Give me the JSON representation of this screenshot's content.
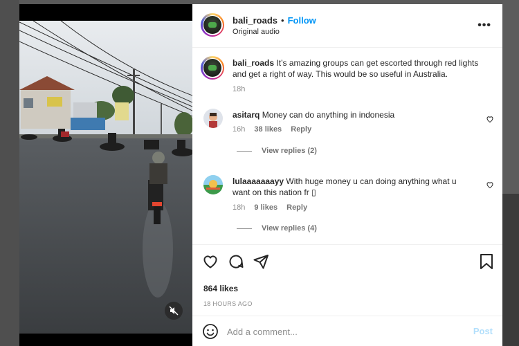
{
  "post": {
    "username": "bali_roads",
    "separator": "•",
    "follow_label": "Follow",
    "audio": "Original audio",
    "more_glyph": "•••"
  },
  "caption": {
    "username": "bali_roads",
    "text": "It’s amazing groups can get escorted through red lights and get a right of way. This would be so useful in Australia.",
    "time": "18h"
  },
  "comments": [
    {
      "username": "asitarq",
      "text": "Money can do anything in indonesia",
      "time": "16h",
      "likes": "38 likes",
      "reply_label": "Reply",
      "view_replies": "View replies (2)"
    },
    {
      "username": "lulaaaaaaayy",
      "text": "With huge money u can doing anything what u want on this nation fr ▯",
      "time": "18h",
      "likes": "9 likes",
      "reply_label": "Reply",
      "view_replies": "View replies (4)"
    }
  ],
  "engagement": {
    "likes": "864 likes",
    "posted": "18 HOURS AGO"
  },
  "comment_box": {
    "placeholder": "Add a comment...",
    "post_label": "Post"
  },
  "icons": {
    "like": "heart-icon",
    "comment": "comment-bubble-icon",
    "share": "paper-plane-icon",
    "save": "bookmark-icon",
    "emoji": "smiley-icon",
    "mute": "speaker-muted-icon",
    "more": "more-options-icon"
  },
  "colors": {
    "accent": "#0095f6",
    "text": "#262626",
    "muted": "#8e8e8e",
    "post_disabled": "#b2dffc"
  }
}
